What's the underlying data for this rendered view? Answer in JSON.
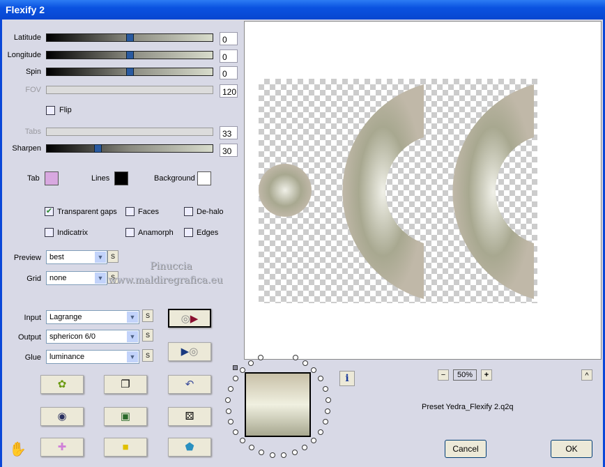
{
  "window": {
    "title": "Flexify 2"
  },
  "sliders": [
    {
      "label": "Latitude",
      "value": "0",
      "level": 0.5,
      "enabled": true
    },
    {
      "label": "Longitude",
      "value": "0",
      "level": 0.5,
      "enabled": true
    },
    {
      "label": "Spin",
      "value": "0",
      "level": 0.5,
      "enabled": true
    },
    {
      "label": "FOV",
      "value": "120",
      "enabled": false
    },
    {
      "label": "Tabs",
      "value": "33",
      "enabled": false
    },
    {
      "label": "Sharpen",
      "value": "30",
      "level": 0.3,
      "enabled": true
    }
  ],
  "flip": {
    "label": "Flip",
    "checked": false
  },
  "colors": {
    "tab_label": "Tab",
    "tab": "#d8a8e0",
    "lines_label": "Lines",
    "lines": "#000000",
    "background_label": "Background",
    "background": "#ffffff"
  },
  "options": [
    {
      "label": "Transparent gaps",
      "checked": true
    },
    {
      "label": "Faces",
      "checked": false
    },
    {
      "label": "De-halo",
      "checked": false
    },
    {
      "label": "Indicatrix",
      "checked": false
    },
    {
      "label": "Anamorph",
      "checked": false
    },
    {
      "label": "Edges",
      "checked": false
    }
  ],
  "preview_select": {
    "label": "Preview",
    "value": "best"
  },
  "grid_select": {
    "label": "Grid",
    "value": "none"
  },
  "input_select": {
    "label": "Input",
    "value": "Lagrange"
  },
  "output_select": {
    "label": "Output",
    "value": "sphericon 6/0"
  },
  "glue_select": {
    "label": "Glue",
    "value": "luminance"
  },
  "s_label": "S",
  "watermark": {
    "line1": "Pinuccia",
    "line2": "www.maldiregrafica.eu"
  },
  "zoom": {
    "minus": "−",
    "value": "50%",
    "plus": "+",
    "up": "^"
  },
  "info": "i",
  "preset": "Preset Yedra_Flexify 2.q2q",
  "cancel": "Cancel",
  "ok": "OK"
}
